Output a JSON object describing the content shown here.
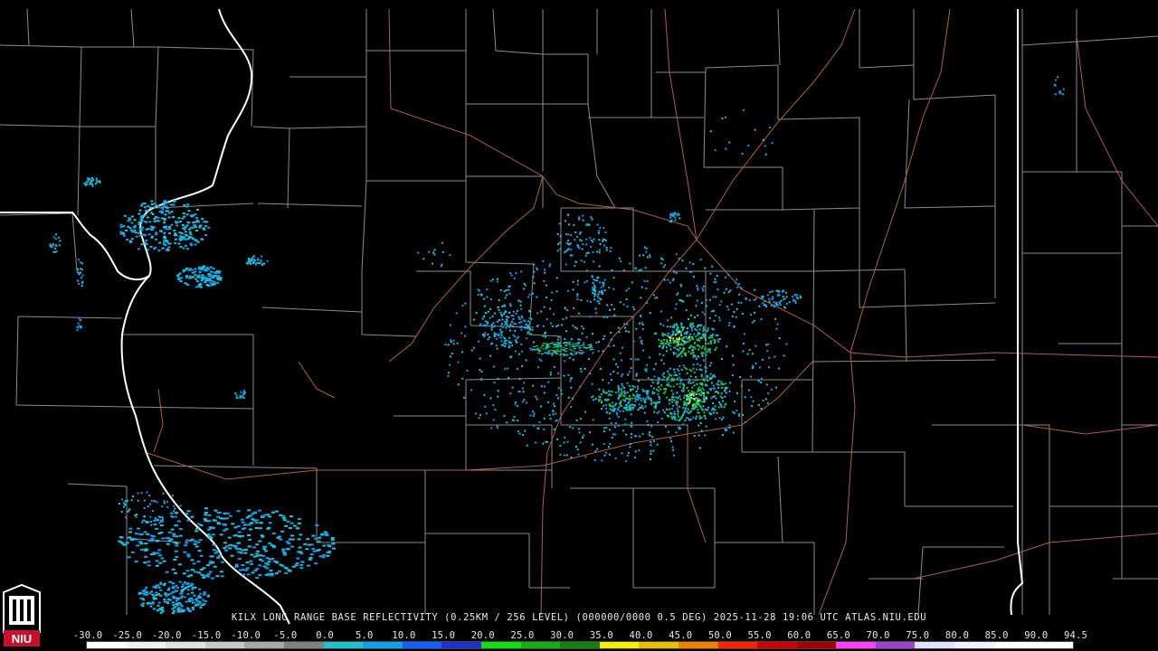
{
  "caption": "KILX LONG RANGE BASE REFLECTIVITY (0.25KM / 256 LEVEL) (000000/0000 0.5 DEG) 2025-11-28 19:06 UTC  ATLAS.NIU.EDU",
  "logo": {
    "text": "NIU",
    "icon": "niu-tower-logo-icon",
    "color": "#c8102e"
  },
  "colorbar": {
    "labels": [
      "-30.0",
      "-25.0",
      "-20.0",
      "-15.0",
      "-10.0",
      "-5.0",
      "0.0",
      "5.0",
      "10.0",
      "15.0",
      "20.0",
      "25.0",
      "30.0",
      "35.0",
      "40.0",
      "45.0",
      "50.0",
      "55.0",
      "60.0",
      "65.0",
      "70.0",
      "75.0",
      "80.0",
      "85.0",
      "90.0",
      "94.5"
    ],
    "colors": [
      "#ffffff",
      "#f0f0f0",
      "#e0e0e0",
      "#c8c8c8",
      "#a8a8a8",
      "#808080",
      "#20c0d0",
      "#10a0f0",
      "#1060ff",
      "#2030d0",
      "#10e010",
      "#10b010",
      "#108010",
      "#f0f000",
      "#e8c000",
      "#f08000",
      "#ff2000",
      "#d00000",
      "#a00000",
      "#ff40ff",
      "#a040d0",
      "#e0e0ff",
      "#f0f0ff",
      "#ffffff",
      "#ffffff"
    ]
  },
  "map_colors": {
    "state_border": "#ffffff",
    "county_border": "#8c8c8c",
    "highway": "#b06040",
    "echo_light": "#18c8e0",
    "echo_medium": "#10a0f0",
    "echo_strong": "#10e010",
    "echo_heavy": "#f0f000"
  }
}
